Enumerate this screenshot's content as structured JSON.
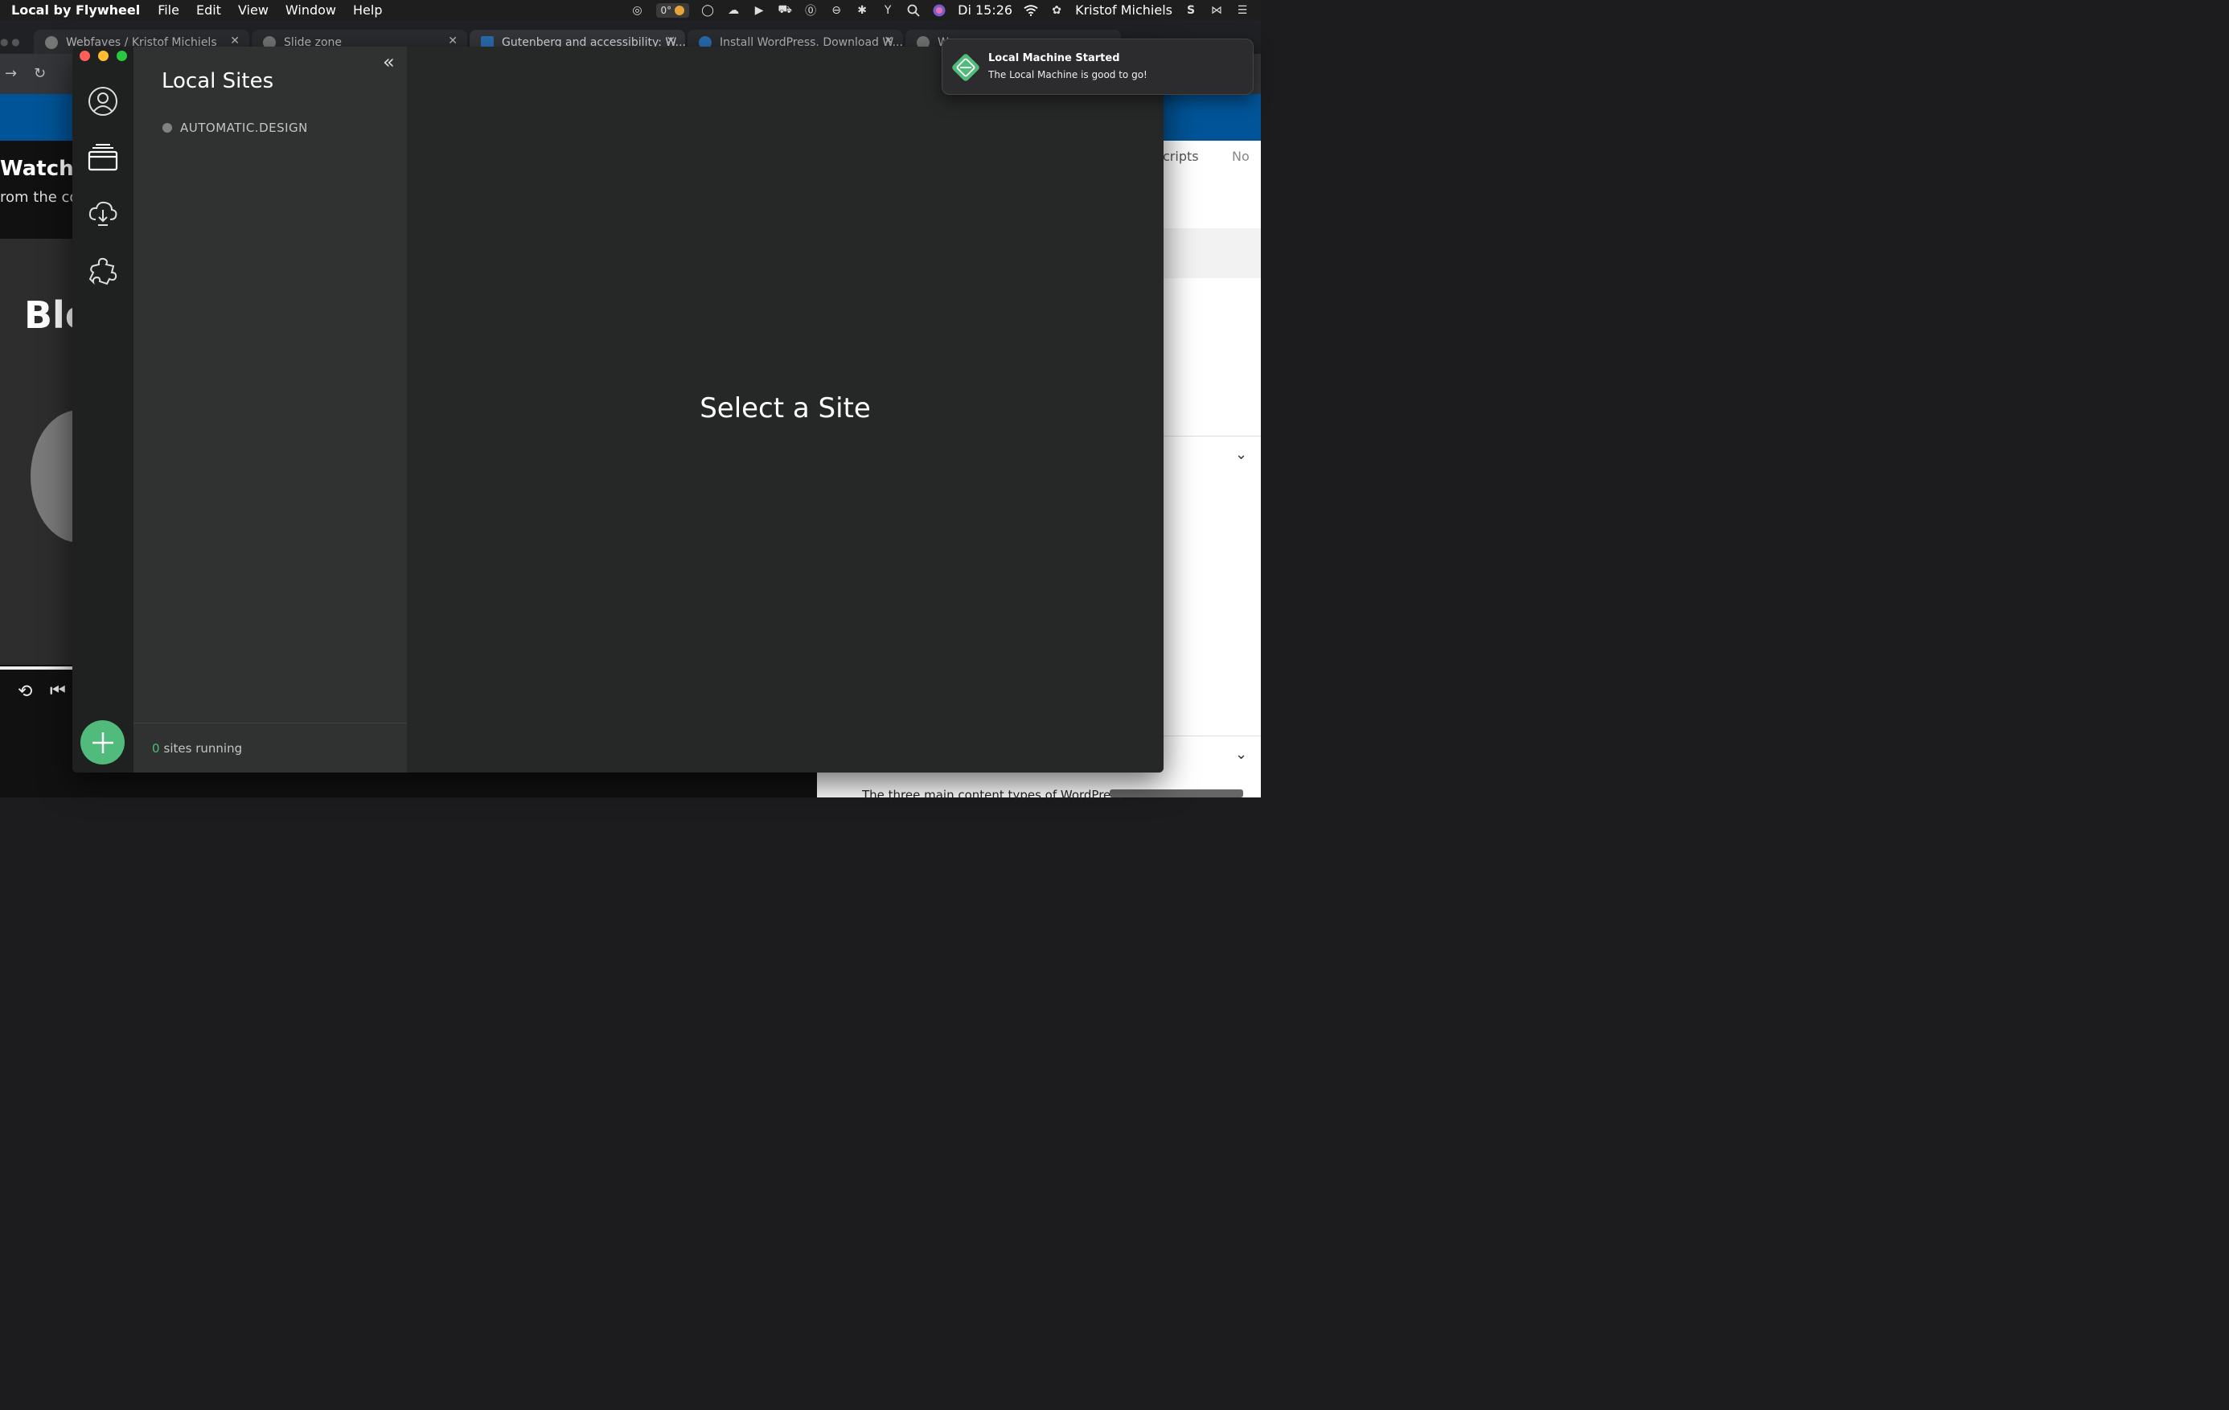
{
  "menubar": {
    "app_name": "Local by Flywheel",
    "menus": [
      "File",
      "Edit",
      "View",
      "Window",
      "Help"
    ],
    "temperature": "0°",
    "clock": "Di 15:26",
    "user": "Kristof Michiels"
  },
  "browser": {
    "tabs": [
      {
        "title": "Webfaves / Kristof Michiels"
      },
      {
        "title": "Slide zone"
      },
      {
        "title": "Gutenberg and accessibility: W..."
      },
      {
        "title": "Install WordPress. Download W..."
      },
      {
        "title": "W"
      }
    ],
    "left_heading": "Watchin",
    "left_subheading": "rom the cou",
    "video_text": "Blo",
    "right_tab_scripts": "cripts",
    "right_tab_notes": "No",
    "right_body_text": "The three main content types of WordPress"
  },
  "local_app": {
    "panel_title": "Local Sites",
    "sites": [
      {
        "name": "AUTOMATIC.DESIGN",
        "status_color": "#828282"
      }
    ],
    "footer": {
      "running_count": "0",
      "running_label": "sites running"
    },
    "main_message": "Select a Site",
    "accent_color": "#51bb7b"
  },
  "notification": {
    "title": "Local Machine Started",
    "body": "The Local Machine is good to go!"
  }
}
